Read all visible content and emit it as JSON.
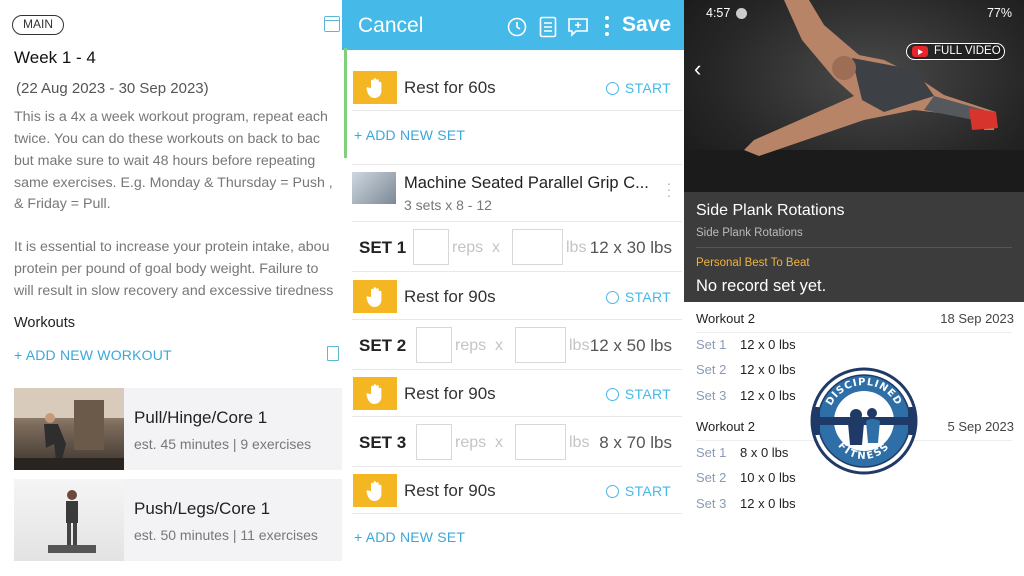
{
  "left": {
    "tag": "MAIN",
    "week_title": "Week 1 - 4",
    "date_range": "(22 Aug 2023 - 30 Sep 2023)",
    "desc_lines": [
      "This is a 4x a week workout program, repeat each",
      "twice.  You can do these workouts on back to bac",
      "but make sure to wait 48 hours before repeating",
      "same exercises.  E.g. Monday & Thursday = Push ,",
      "& Friday = Pull.",
      "",
      "It is essential to increase your protein intake, abou",
      "protein per pound of goal body weight.  Failure to",
      "will result in slow recovery and excessive tiredness"
    ],
    "workouts_title": "Workouts",
    "add_workout": "+ ADD NEW WORKOUT",
    "cards": [
      {
        "title": "Pull/Hinge/Core 1",
        "sub": "est. 45 minutes | 9 exercises"
      },
      {
        "title": "Push/Legs/Core 1",
        "sub": "est. 50 minutes | 11 exercises"
      }
    ]
  },
  "mid": {
    "cancel": "Cancel",
    "save": "Save",
    "rest1": "Rest for 60s",
    "start": "START",
    "add_set": "+ ADD NEW SET",
    "exercise": {
      "title": "Machine Seated Parallel Grip C...",
      "sub": "3 sets x 8 - 12"
    },
    "sets": [
      {
        "label": "SET 1",
        "reps": "reps",
        "x": "x",
        "lbs": "lbs",
        "prev": "12 x 30 lbs",
        "rest": "Rest for 90s"
      },
      {
        "label": "SET 2",
        "reps": "reps",
        "x": "x",
        "lbs": "lbs",
        "prev": "12 x 50 lbs",
        "rest": "Rest for 90s"
      },
      {
        "label": "SET 3",
        "reps": "reps",
        "x": "x",
        "lbs": "lbs",
        "prev": "8 x 70 lbs",
        "rest": "Rest for 90s"
      }
    ],
    "add_set2": "+ ADD NEW SET"
  },
  "right": {
    "status_time": "4:57",
    "status_batt": "77%",
    "full_video": "FULL VIDEO",
    "exercise_name": "Side Plank Rotations",
    "exercise_sub": "Side Plank Rotations",
    "pb_label": "Personal Best To Beat",
    "pb_value": "No record set yet.",
    "history": [
      {
        "title": "Workout 2",
        "date": "18 Sep 2023",
        "sets": [
          {
            "set": "Set 1",
            "val": "12 x 0 lbs"
          },
          {
            "set": "Set 2",
            "val": "12 x 0 lbs"
          },
          {
            "set": "Set 3",
            "val": "12 x 0 lbs"
          }
        ]
      },
      {
        "title": "Workout 2",
        "date": "5 Sep 2023",
        "sets": [
          {
            "set": "Set 1",
            "val": "8 x 0 lbs"
          },
          {
            "set": "Set 2",
            "val": "10 x 0 lbs"
          },
          {
            "set": "Set 3",
            "val": "12 x 0 lbs"
          }
        ]
      }
    ],
    "logo_top": "DISCIPLINED",
    "logo_bottom": "FITNESS"
  },
  "colors": {
    "accent": "#45b9e8",
    "rest": "#f5b623",
    "pb": "#f0b33c"
  }
}
